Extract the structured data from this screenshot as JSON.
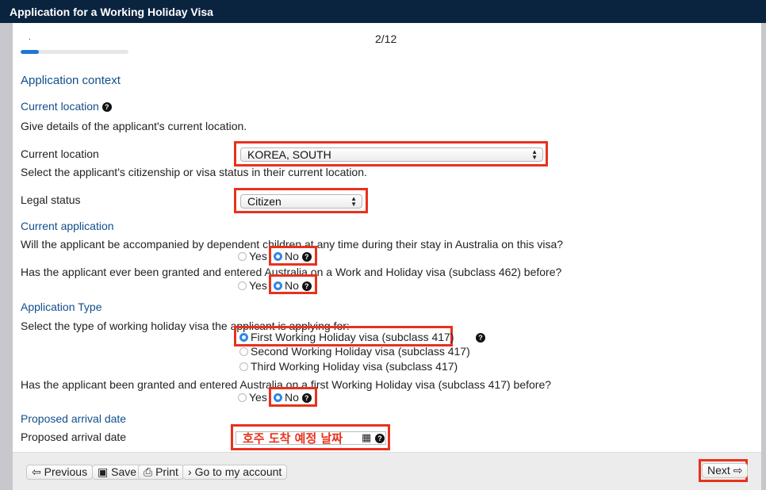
{
  "header": {
    "title": "Application for a Working Holiday Visa"
  },
  "progress": {
    "dot": ".",
    "step": "2/12",
    "fraction": 0.167
  },
  "section": {
    "title": "Application context",
    "current_location_heading": "Current location",
    "current_location_desc": "Give details of the applicant's current location.",
    "current_location_label": "Current location",
    "current_location_value": "KOREA, SOUTH",
    "citizenship_desc": "Select the applicant's citizenship or visa status in their current location.",
    "legal_status_label": "Legal status",
    "legal_status_value": "Citizen"
  },
  "current_application": {
    "heading": "Current application",
    "q1": "Will the applicant be accompanied by dependent children at any time during their stay in Australia on this visa?",
    "q2": "Has the applicant ever been granted and entered Australia on a Work and Holiday visa (subclass 462) before?",
    "yes": "Yes",
    "no": "No"
  },
  "application_type": {
    "heading": "Application Type",
    "question": "Select the type of working holiday visa the applicant is applying for:",
    "options": [
      "First Working Holiday visa (subclass 417)",
      "Second Working Holiday visa (subclass 417)",
      "Third Working Holiday visa (subclass 417)"
    ],
    "q_prior": "Has the applicant been granted and entered Australia on a first Working Holiday visa (subclass 417) before?"
  },
  "arrival": {
    "heading": "Proposed arrival date",
    "label": "Proposed arrival date",
    "annotation": "호주 도착 예정 날짜"
  },
  "footer": {
    "previous": "Previous",
    "save": "Save",
    "print": "Print",
    "account": "Go to my account",
    "next": "Next"
  },
  "colors": {
    "header": "#0a2440",
    "link_blue": "#124e8c",
    "highlight": "#e8321c",
    "radio": "#2f87e6"
  }
}
